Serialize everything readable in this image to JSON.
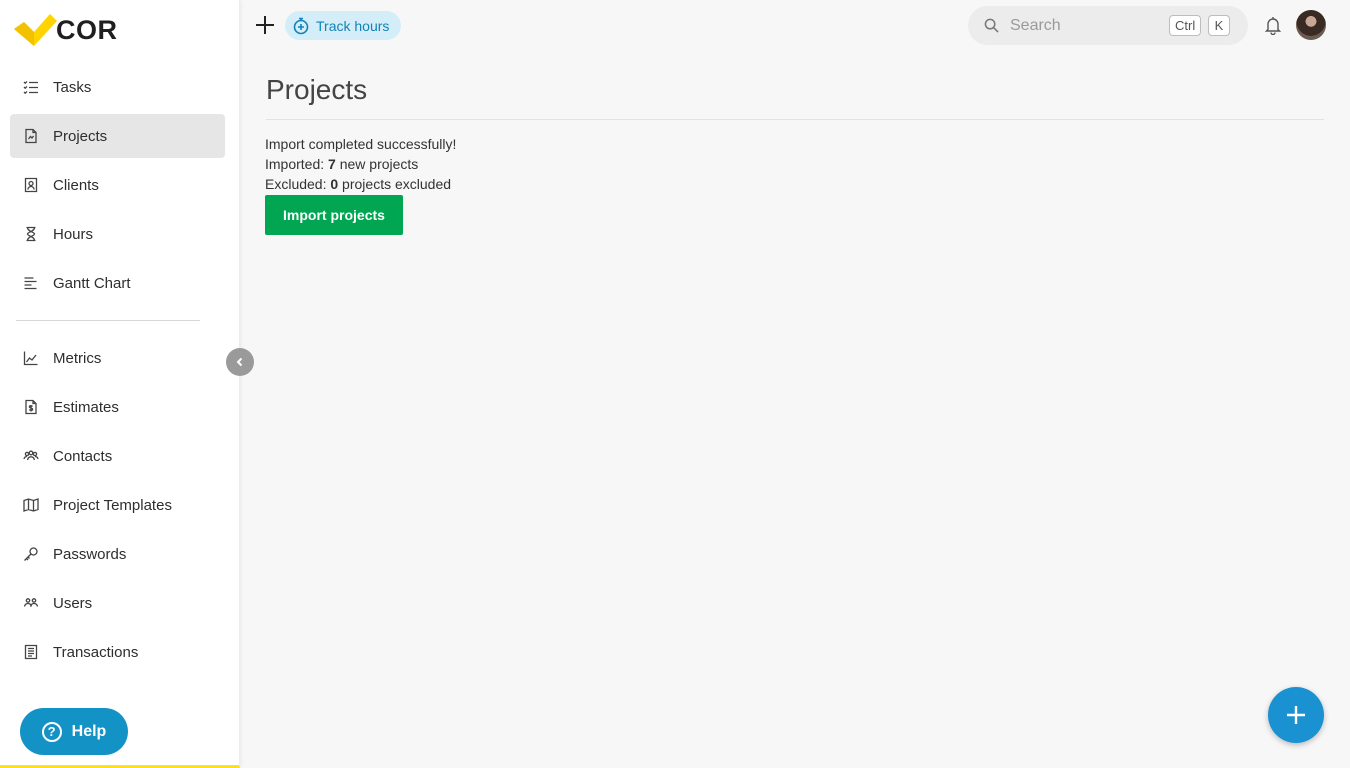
{
  "brand": {
    "name": "COR",
    "accent": "#ffd400"
  },
  "sidebar": {
    "primary": [
      {
        "label": "Tasks",
        "icon": "tasks-icon",
        "active": false
      },
      {
        "label": "Projects",
        "icon": "projects-icon",
        "active": true
      },
      {
        "label": "Clients",
        "icon": "clients-icon",
        "active": false
      },
      {
        "label": "Hours",
        "icon": "hourglass-icon",
        "active": false
      },
      {
        "label": "Gantt Chart",
        "icon": "gantt-icon",
        "active": false
      }
    ],
    "secondary": [
      {
        "label": "Metrics",
        "icon": "metrics-icon"
      },
      {
        "label": "Estimates",
        "icon": "estimates-icon"
      },
      {
        "label": "Contacts",
        "icon": "contacts-icon"
      },
      {
        "label": "Project Templates",
        "icon": "map-icon"
      },
      {
        "label": "Passwords",
        "icon": "key-icon"
      },
      {
        "label": "Users",
        "icon": "users-icon"
      },
      {
        "label": "Transactions",
        "icon": "transactions-icon"
      }
    ],
    "help_label": "Help",
    "help_glyph": "?"
  },
  "topbar": {
    "track_hours_label": "Track hours",
    "search_placeholder": "Search",
    "shortcut_keys": [
      "Ctrl",
      "K"
    ]
  },
  "main": {
    "title": "Projects",
    "status_message": "Import completed successfully!",
    "imported": {
      "prefix": "Imported: ",
      "count": "7",
      "suffix": " new projects"
    },
    "excluded": {
      "prefix": "Excluded: ",
      "count": "0",
      "suffix": " projects excluded"
    },
    "import_button_label": "Import projects"
  },
  "colors": {
    "import_button": "#00a651",
    "fab": "#1a91d0",
    "help_button": "#1392c6",
    "track_hours_bg": "#d4eef9"
  }
}
